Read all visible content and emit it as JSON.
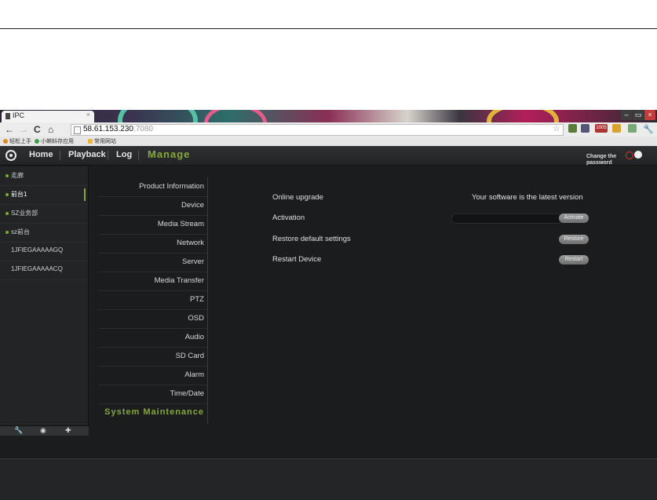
{
  "browser": {
    "tab_title": "IPC",
    "tab_close": "×",
    "nav": {
      "back": "←",
      "forward": "→",
      "reload": "C",
      "home": "⌂"
    },
    "url_host": "58.61.153.230",
    "url_port": ":7080",
    "bookmarks": [
      "轻松上手",
      "小蝌蚪存应用",
      "常用网站"
    ],
    "window_controls": {
      "minimize": "–",
      "maximize": "▭",
      "close": "×"
    },
    "badge_count": "1005",
    "icons": [
      "bookmark-star-icon",
      "signal-icon",
      "mail-icon",
      "extension-icon",
      "wrench-icon"
    ]
  },
  "app": {
    "nav": {
      "home": "Home",
      "playback": "Playback",
      "log": "Log",
      "manage": "Manage"
    },
    "change_password": "Change the password",
    "accent_color": "#86a83a"
  },
  "devices": [
    {
      "label": "走廊",
      "online": true
    },
    {
      "label": "前台1",
      "online": true,
      "selected": true
    },
    {
      "label": "SZ业务部",
      "online": true
    },
    {
      "label": "sz前台",
      "online": true
    },
    {
      "label": "1JFIEGAAAAAGQ",
      "online": false
    },
    {
      "label": "1JFIEGAAAAACQ",
      "online": false
    }
  ],
  "tools": {
    "settings": "🔧",
    "search": "◉",
    "add": "✚"
  },
  "menu": [
    "Product Information",
    "Device",
    "Media Stream",
    "Network",
    "Server",
    "Media Transfer",
    "PTZ",
    "OSD",
    "Audio",
    "SD Card",
    "Alarm",
    "Time/Date",
    "System Maintenance"
  ],
  "maintenance": {
    "online_upgrade": "Online upgrade",
    "upgrade_status": "Your software is the latest version",
    "activation": "Activation",
    "activate_button": "Activate",
    "restore": "Restore default settings",
    "restore_button": "Restore",
    "restart": "Restart Device",
    "restart_button": "Restart"
  }
}
